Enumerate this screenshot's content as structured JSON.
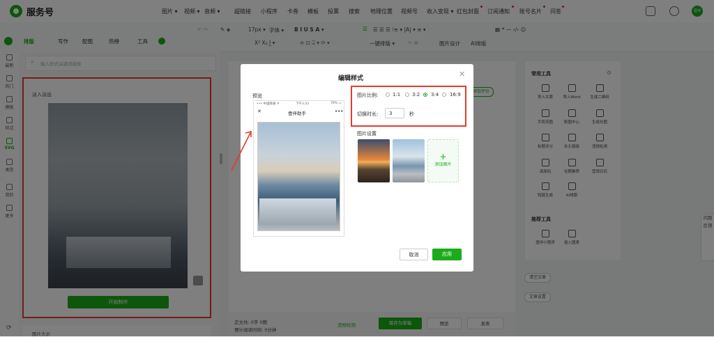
{
  "header": {
    "app_title": "服务号",
    "menu": [
      {
        "label": "图片 ▾"
      },
      {
        "label": "视频 ▾"
      },
      {
        "label": "音频 ▾"
      },
      {
        "label": "超链接"
      },
      {
        "label": "小程序"
      },
      {
        "label": "卡券"
      },
      {
        "label": "模板"
      },
      {
        "label": "投票"
      },
      {
        "label": "搜索"
      },
      {
        "label": "地理位置"
      },
      {
        "label": "视频号"
      },
      {
        "label": "收入变现 ▾"
      },
      {
        "label": "红包封面"
      },
      {
        "label": "订阅通知"
      },
      {
        "label": "账号名片"
      },
      {
        "label": "问答"
      }
    ],
    "avatar_text": "壹伴"
  },
  "toolbar": {
    "font_size": "17px ▾",
    "font": "字体 ▾",
    "format_row": "B  I  U  S  A ▾",
    "row2": "X²  X₂  I̲  ▾",
    "one_click": "一键排版 ▾",
    "image_design": "图片设计",
    "ai_layout": "AI排版",
    "tabs": [
      {
        "label": "排版"
      },
      {
        "label": "写作"
      },
      {
        "label": "配图"
      },
      {
        "label": "热榜"
      },
      {
        "label": "工具"
      }
    ]
  },
  "rail": [
    {
      "label": "最新"
    },
    {
      "label": "热门"
    },
    {
      "label": "模板"
    },
    {
      "label": "样式"
    },
    {
      "label": "SVG"
    },
    {
      "label": "类型"
    },
    {
      "label": "我的"
    },
    {
      "label": "更多"
    }
  ],
  "library": {
    "search_placeholder": "输入样式关键词搜索",
    "card_title": "淡入淡出",
    "start_button": "开始制作",
    "next_card_title": "图片大示"
  },
  "editor": {
    "floating_btn": "添加评价"
  },
  "bottombar": {
    "word_count": "正文共: 0字 0图",
    "read_time": "预计阅读时间: 0分钟",
    "preview_check": "违规检测",
    "save_draft": "保存为草稿",
    "preview": "预览",
    "publish": "发表"
  },
  "right_panel": {
    "common_tools_title": "常用工具",
    "common_tools": [
      {
        "label": "导入文章"
      },
      {
        "label": "导入Word"
      },
      {
        "label": "生成二维码"
      },
      {
        "label": "手机传图"
      },
      {
        "label": "配图中心"
      },
      {
        "label": "生成长图"
      },
      {
        "label": "标题评分"
      },
      {
        "label": "永久链接"
      },
      {
        "label": "违规检测"
      },
      {
        "label": "读原码"
      },
      {
        "label": "往期推荐"
      },
      {
        "label": "营销日历"
      },
      {
        "label": "短链生成"
      },
      {
        "label": "AI排版"
      }
    ],
    "recommend_title": "推荐工具",
    "recommend_tools": [
      {
        "label": "壹伴小程序"
      },
      {
        "label": "插入图表"
      }
    ],
    "clear_article": "清空文章",
    "article_settings": "文章设置"
  },
  "feedback": "问题反馈",
  "modal": {
    "title": "编辑样式",
    "preview_label": "预览",
    "phone_status": "••• 中国联通 ᯤ",
    "phone_time": "下午3:33",
    "phone_battery": "78% ▭",
    "phone_title": "壹伴助手",
    "ratio_label": "图片比例:",
    "ratios": [
      {
        "label": "1:1",
        "selected": false
      },
      {
        "label": "3:2",
        "selected": false
      },
      {
        "label": "3:4",
        "selected": true
      },
      {
        "label": "16:9",
        "selected": false
      }
    ],
    "duration_label": "切换时长:",
    "duration_value": "3",
    "duration_unit": "秒",
    "image_settings_label": "图片设置",
    "add_image": "添加图片",
    "cancel": "取消",
    "apply": "应用"
  },
  "colors": {
    "brand_green": "#1aad19",
    "highlight_red": "#e63a2e"
  }
}
